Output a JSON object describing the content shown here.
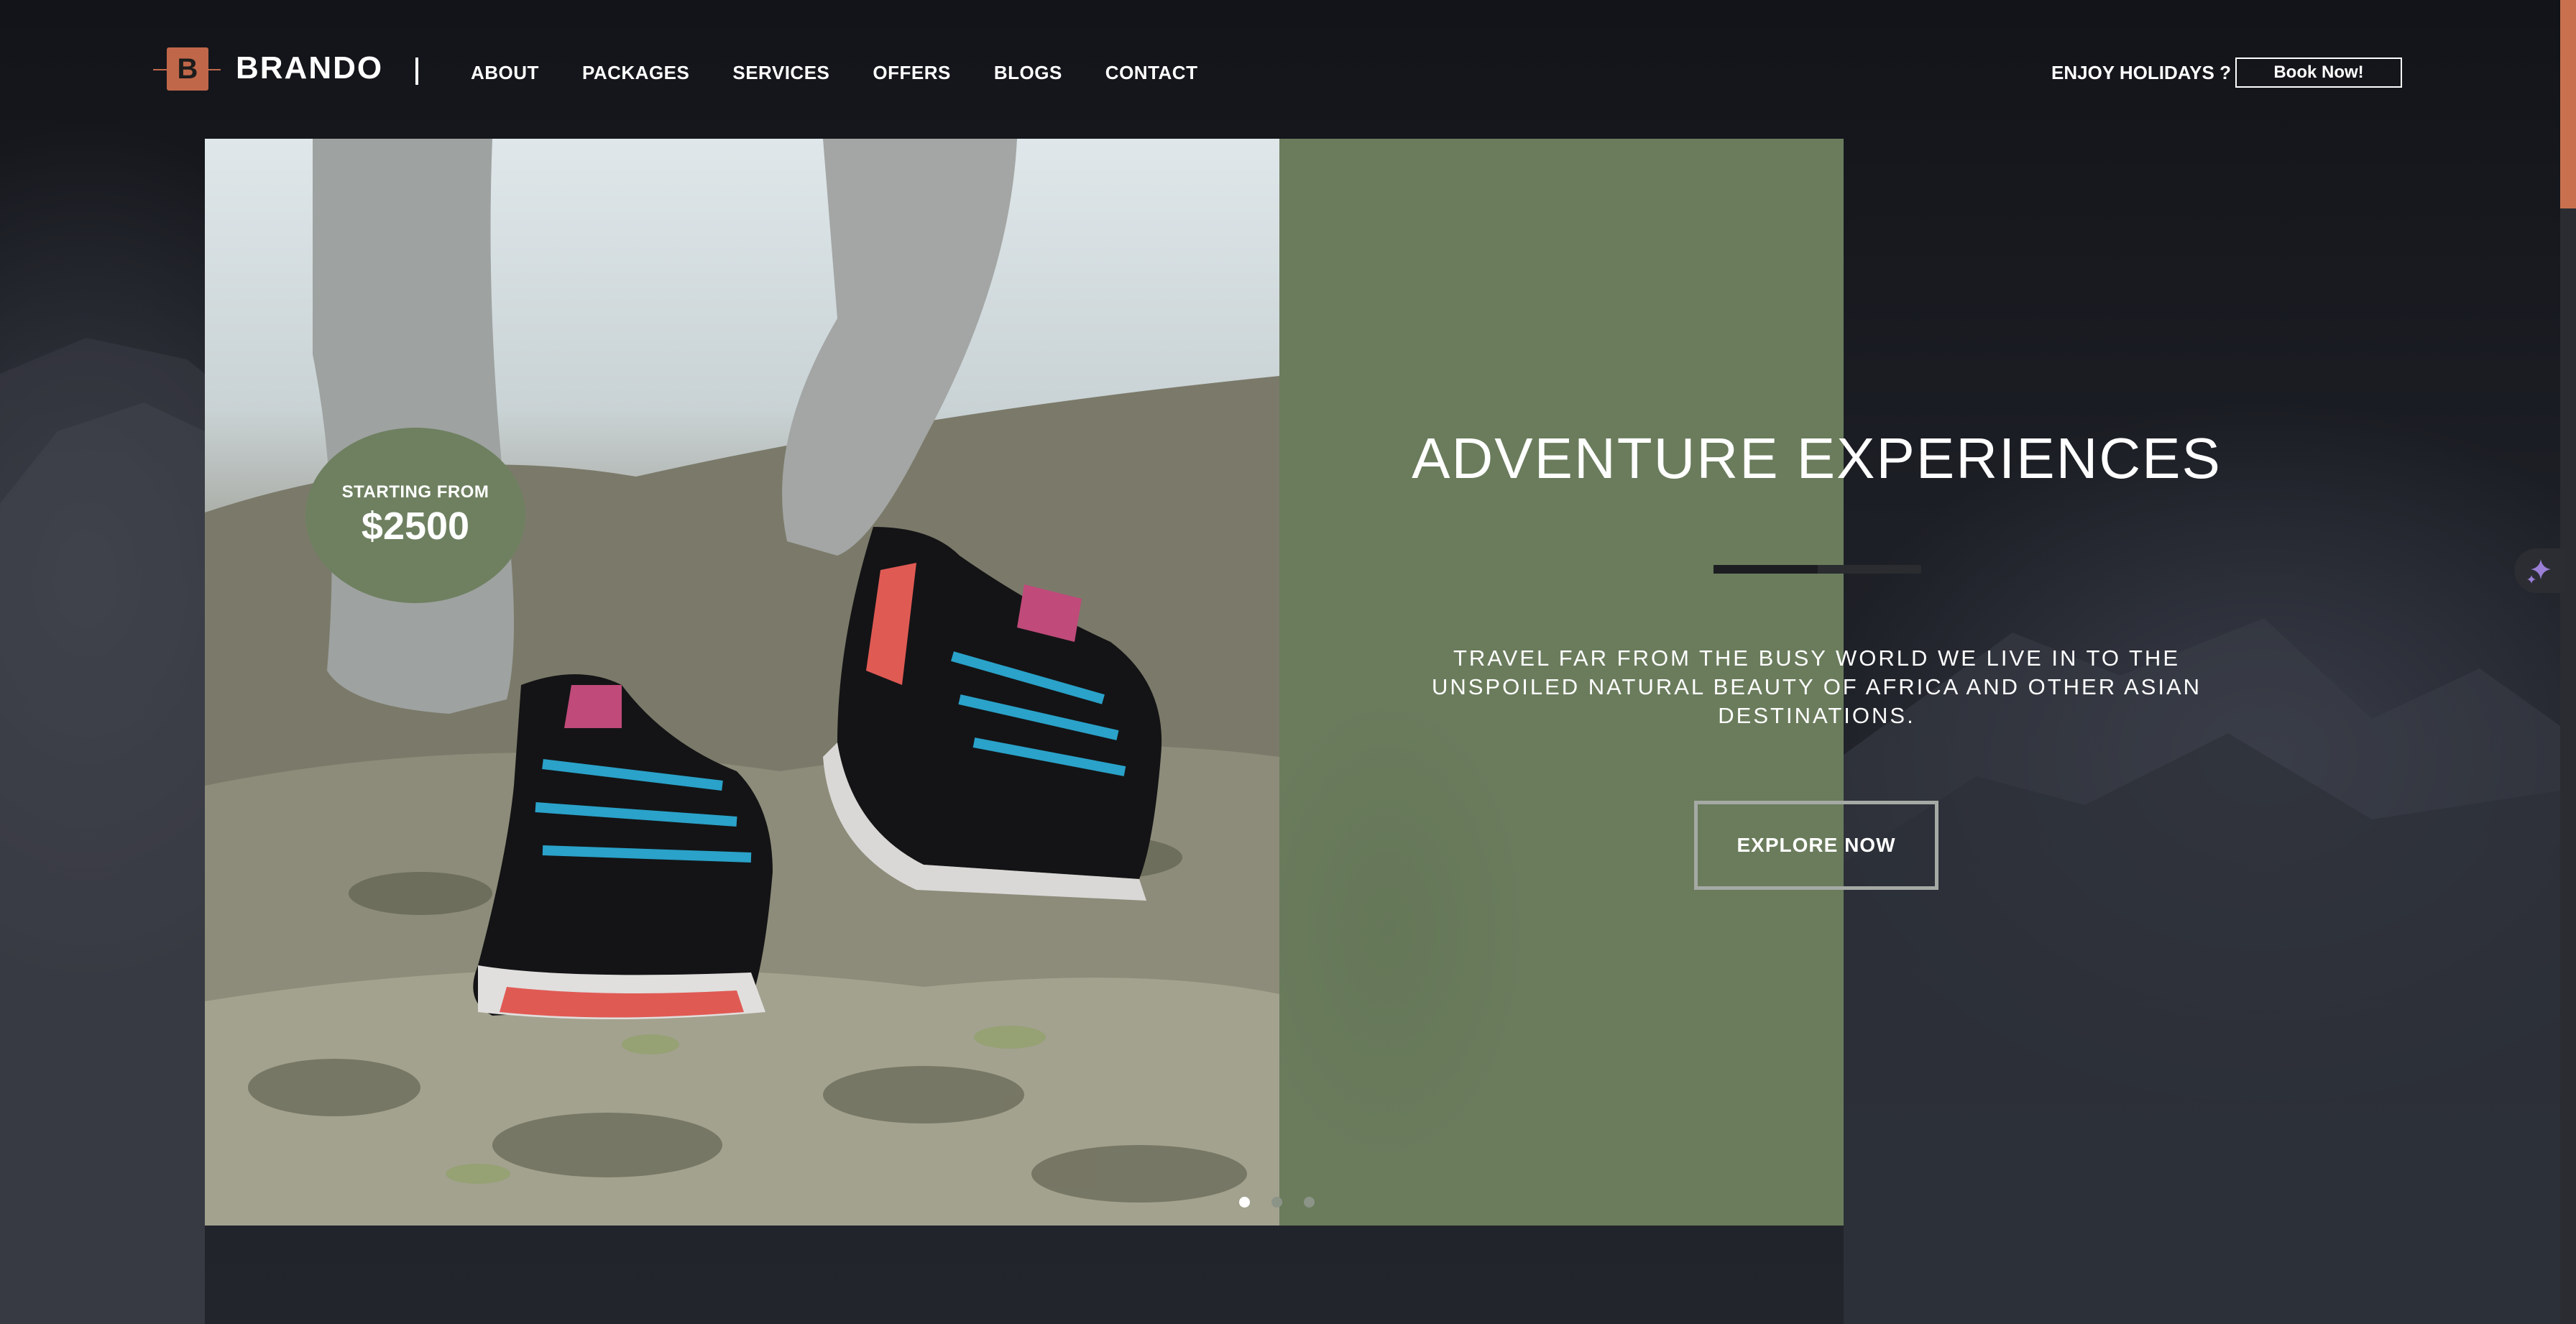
{
  "brand": {
    "logo_letter": "B",
    "name": "BRANDO"
  },
  "nav": {
    "items": [
      "ABOUT",
      "PACKAGES",
      "SERVICES",
      "OFFERS",
      "BLOGS",
      "CONTACT"
    ]
  },
  "header": {
    "tagline": "ENJOY HOLIDAYS ?",
    "book_label": "Book Now!"
  },
  "badge": {
    "label": "STARTING FROM",
    "price": "$2500"
  },
  "hero": {
    "title": "ADVENTURE EXPERIENCES",
    "description": "TRAVEL FAR FROM THE BUSY WORLD WE LIVE IN TO THE UNSPOILED NATURAL BEAUTY OF AFRICA AND OTHER ASIAN DESTINATIONS.",
    "cta_label": "EXPLORE NOW"
  },
  "slider": {
    "count": 3,
    "active": 0
  },
  "colors": {
    "accent": "#c0674a",
    "panel_green": "#6a7c5c",
    "background": "#1a1c23"
  },
  "icons": {
    "sparkle": "sparkle-icon"
  }
}
